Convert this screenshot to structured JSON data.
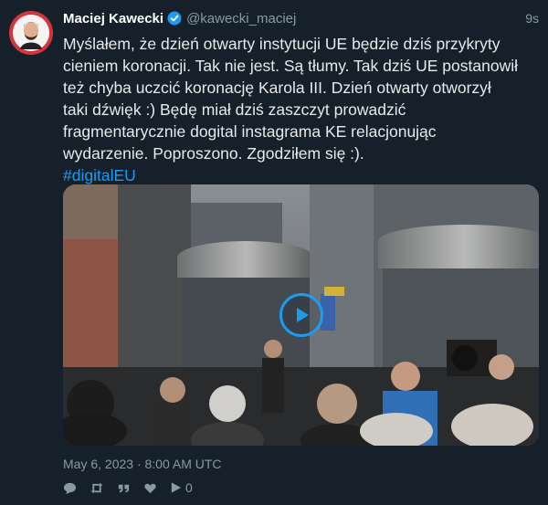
{
  "author": {
    "name": "Maciej Kawecki",
    "handle": "@kawecki_maciej",
    "verified": true
  },
  "time_ago": "9s",
  "text": {
    "body": "Myślałem, że dzień otwarty instytucji UE będzie dziś przykryty cieniem koronacji. Tak nie jest. Są tłumy. Tak dziś UE postanowił też chyba uczcić koronację Karola III. Dzień otwarty otworzył taki dźwięk :) Będę miał dziś zaszczyt prowadzić fragmentarycznie dogital instagrama KE relacjonując wydarzenie. Poproszono. Zgodziłem się :).",
    "hashtag": "#digitalEU"
  },
  "media": {
    "type": "video",
    "play_icon": "play-icon"
  },
  "timestamp": "May 6, 2023 · 8:00 AM UTC",
  "actions": {
    "reply_icon": "comment-icon",
    "retweet_icon": "retweet-icon",
    "quote_icon": "quote-icon",
    "like_icon": "heart-icon",
    "views_icon": "play-count-icon",
    "views_count": "0"
  },
  "colors": {
    "background": "#15202b",
    "accent": "#1d9bf0",
    "secondary_text": "#8b98a5"
  }
}
